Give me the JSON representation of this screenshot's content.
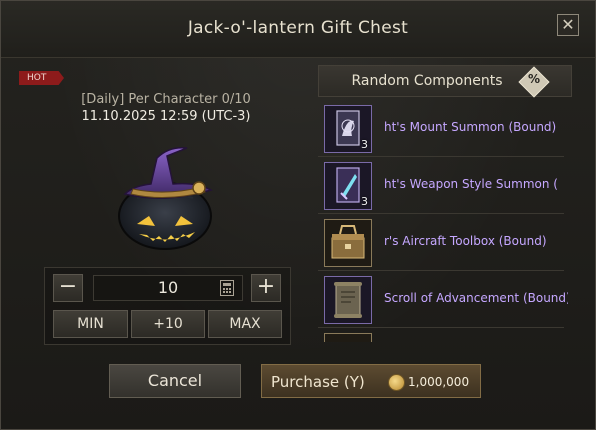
{
  "window": {
    "title": "Jack-o'-lantern Gift Chest",
    "close_label": "✕"
  },
  "badge": "HOT",
  "limit_text": "[Daily] Per Character 0/10",
  "date_text": "11.10.2025 12:59 (UTC-3)",
  "quantity": {
    "value": "10",
    "minus_label": "−",
    "plus_label": "+",
    "min_label": "MIN",
    "plus10_label": "+10",
    "max_label": "MAX"
  },
  "components": {
    "title": "Random Components",
    "percent_glyph": "%",
    "items": [
      {
        "name": "ht's Mount Summon (Bound)",
        "count": "3",
        "icon": "mount-summon-card-icon"
      },
      {
        "name": "ht's Weapon Style Summon (",
        "count": "3",
        "icon": "weapon-style-summon-card-icon"
      },
      {
        "name": "r's Aircraft Toolbox (Bound)",
        "count": "",
        "icon": "aircraft-toolbox-icon"
      },
      {
        "name": "Scroll of Advancement (Bound)",
        "count": "",
        "icon": "advancement-scroll-icon"
      }
    ]
  },
  "footer": {
    "cancel_label": "Cancel",
    "purchase_label": "Purchase (Y)",
    "price": "1,000,000"
  },
  "colors": {
    "item_name": "#c5a7ff",
    "hot_badge": "#8d1b1b",
    "purchase_button": "#5d4b31"
  }
}
